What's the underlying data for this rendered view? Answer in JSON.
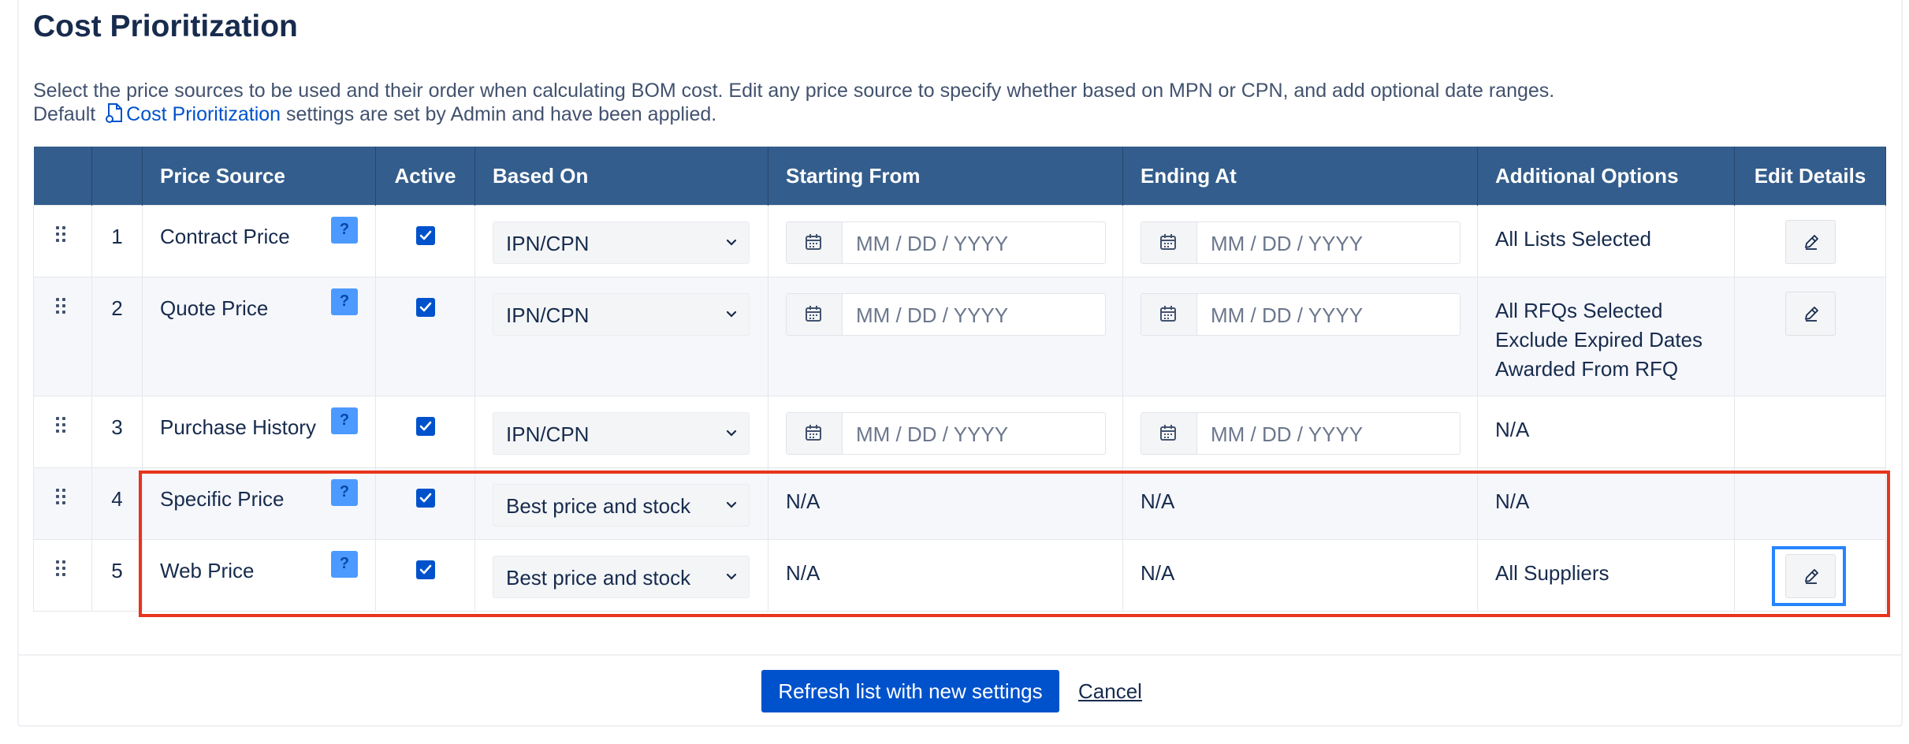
{
  "page": {
    "title": "Cost Prioritization",
    "description_line1": "Select the price sources to be used and their order when calculating BOM cost. Edit any price source to specify whether based on MPN or CPN, and add optional date ranges.",
    "description_prefix": "Default",
    "description_link": "Cost Prioritization",
    "description_suffix": "settings are set by Admin and have been applied."
  },
  "table": {
    "headers": [
      "",
      "",
      "Price Source",
      "Active",
      "Based On",
      "Starting From",
      "Ending At",
      "Additional Options",
      "Edit Details"
    ],
    "rows": [
      {
        "index": "1",
        "source": "Contract Price",
        "active": true,
        "based_on": "IPN/CPN",
        "start_placeholder": "MM / DD / YYYY",
        "end_placeholder": "MM / DD / YYYY",
        "options": "All Lists Selected",
        "editable": true
      },
      {
        "index": "2",
        "source": "Quote Price",
        "active": true,
        "based_on": "IPN/CPN",
        "start_placeholder": "MM / DD / YYYY",
        "end_placeholder": "MM / DD / YYYY",
        "options": "All RFQs Selected\nExclude Expired Dates\nAwarded From RFQ",
        "editable": true
      },
      {
        "index": "3",
        "source": "Purchase History",
        "active": true,
        "based_on": "IPN/CPN",
        "start_placeholder": "MM / DD / YYYY",
        "end_placeholder": "MM / DD / YYYY",
        "options": "N/A",
        "editable": false
      },
      {
        "index": "4",
        "source": "Specific Price",
        "active": true,
        "based_on": "Best price and stock",
        "start_text": "N/A",
        "end_text": "N/A",
        "options": "N/A",
        "editable": false
      },
      {
        "index": "5",
        "source": "Web Price",
        "active": true,
        "based_on": "Best price and stock",
        "start_text": "N/A",
        "end_text": "N/A",
        "options": "All Suppliers",
        "editable": true
      }
    ],
    "help_label": "?"
  },
  "footer": {
    "refresh_label": "Refresh list with new settings",
    "cancel_label": "Cancel"
  },
  "colors": {
    "header_bg": "#335d8c",
    "primary": "#0052cc",
    "highlight_red": "#e8341c",
    "highlight_blue": "#2684ff"
  }
}
